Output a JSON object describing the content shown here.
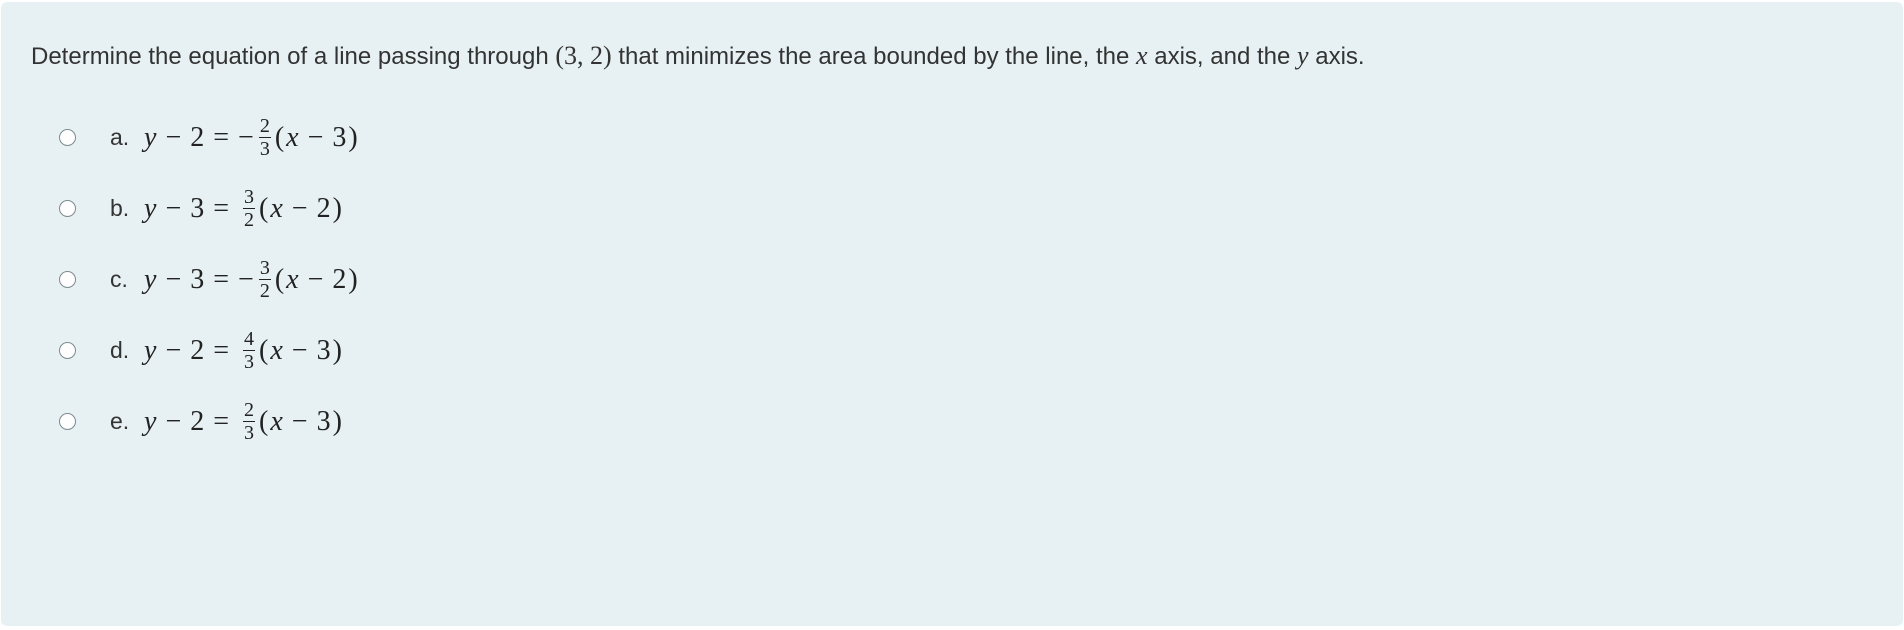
{
  "question": {
    "prompt_pre": "Determine the equation of a line passing through ",
    "point_open": "(",
    "point_x": "3",
    "point_comma": ", ",
    "point_y": "2",
    "point_close": ")",
    "prompt_mid": " that minimizes the area bounded by the line, the ",
    "axis1": "x",
    "prompt_mid2": " axis, and the ",
    "axis2": "y",
    "prompt_end": " axis."
  },
  "options": [
    {
      "letter": "a.",
      "lhs_y_minus": "2",
      "sign": "−",
      "frac_num": "2",
      "frac_den": "3",
      "rhs_x_minus": "3"
    },
    {
      "letter": "b.",
      "lhs_y_minus": "3",
      "sign": "",
      "frac_num": "3",
      "frac_den": "2",
      "rhs_x_minus": "2"
    },
    {
      "letter": "c.",
      "lhs_y_minus": "3",
      "sign": "−",
      "frac_num": "3",
      "frac_den": "2",
      "rhs_x_minus": "2"
    },
    {
      "letter": "d.",
      "lhs_y_minus": "2",
      "sign": "",
      "frac_num": "4",
      "frac_den": "3",
      "rhs_x_minus": "3"
    },
    {
      "letter": "e.",
      "lhs_y_minus": "2",
      "sign": "",
      "frac_num": "2",
      "frac_den": "3",
      "rhs_x_minus": "3"
    }
  ],
  "sym": {
    "y": "y",
    "x": "x",
    "minus": "−",
    "eq": "=",
    "lp": "(",
    "rp": ")"
  }
}
